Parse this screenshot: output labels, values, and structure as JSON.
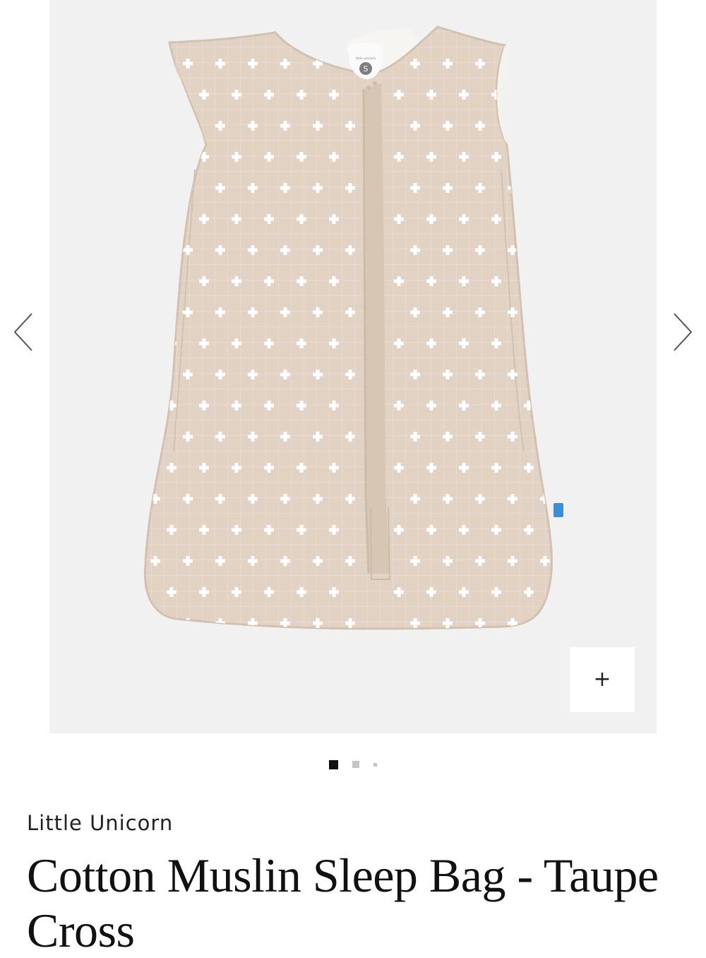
{
  "gallery": {
    "image_alt": "Cotton Muslin Sleep Bag - Taupe Cross",
    "size_tag": "S",
    "label_text": "little unicorn",
    "prev_icon": "chevron-left-icon",
    "next_icon": "chevron-right-icon",
    "zoom_label": "+",
    "slide_count": 3,
    "active_slide": 1
  },
  "colors": {
    "fabric": "#e2d2c3",
    "fabric_shadow": "#cdbcab",
    "cross": "#ffffff",
    "background": "#f1f1f1"
  },
  "product": {
    "brand": "Little Unicorn",
    "title": "Cotton Muslin Sleep Bag - Taupe Cross"
  }
}
